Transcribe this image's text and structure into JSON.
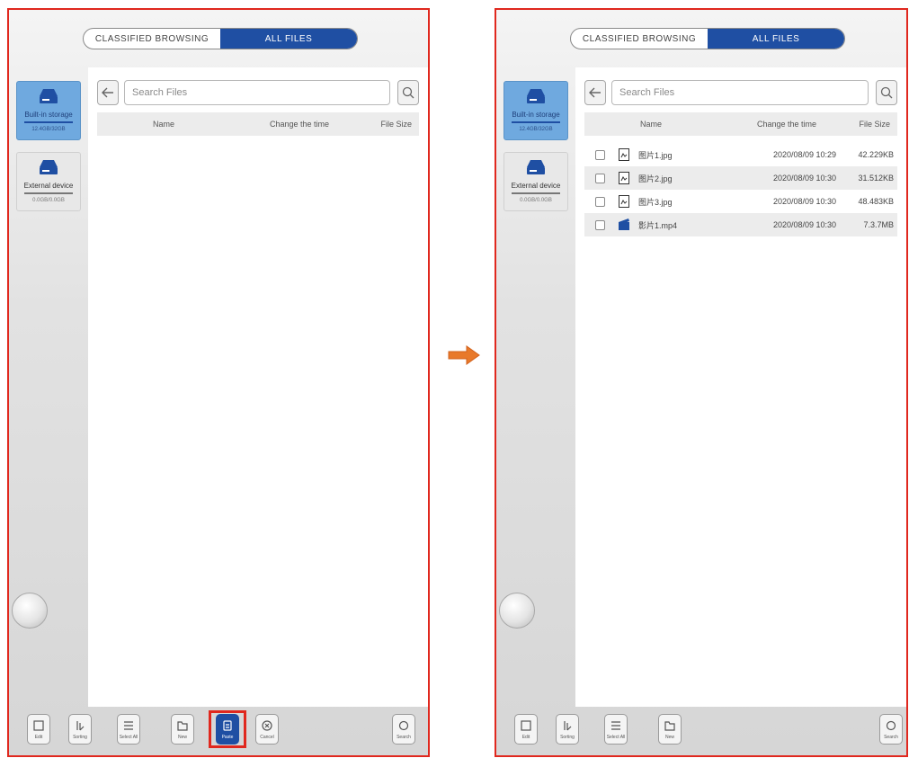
{
  "colors": {
    "accent": "#1f4fa3",
    "highlight": "#e0281e",
    "arrow": "#e8792a",
    "selected_storage": "#6fa9df"
  },
  "tabs": {
    "classified": "CLASSIFIED BROWSING",
    "all_files": "ALL FILES"
  },
  "sidebar": {
    "internal": {
      "label": "Built-in storage",
      "sub": "12.4GB/32GB",
      "icon": "drive-icon"
    },
    "external": {
      "label": "External device",
      "sub": "0.0GB/0.0GB",
      "icon": "drive-icon"
    }
  },
  "search": {
    "placeholder": "Search Files"
  },
  "table": {
    "headers": {
      "name": "Name",
      "time": "Change the time",
      "size": "File Size"
    }
  },
  "files": [
    {
      "name": "图片1.jpg",
      "time": "2020/08/09 10:29",
      "size": "42.229KB",
      "type": "image"
    },
    {
      "name": "图片2.jpg",
      "time": "2020/08/09 10:30",
      "size": "31.512KB",
      "type": "image"
    },
    {
      "name": "图片3.jpg",
      "time": "2020/08/09 10:30",
      "size": "48.483KB",
      "type": "image"
    },
    {
      "name": "影片1.mp4",
      "time": "2020/08/09 10:30",
      "size": "7.3.7MB",
      "type": "video"
    }
  ],
  "toolbar": {
    "edit": "Edit",
    "sorting": "Sorting",
    "select_all": "Select All",
    "new": "New",
    "paste": "Paste",
    "cancel": "Cancel",
    "search": "Search"
  }
}
